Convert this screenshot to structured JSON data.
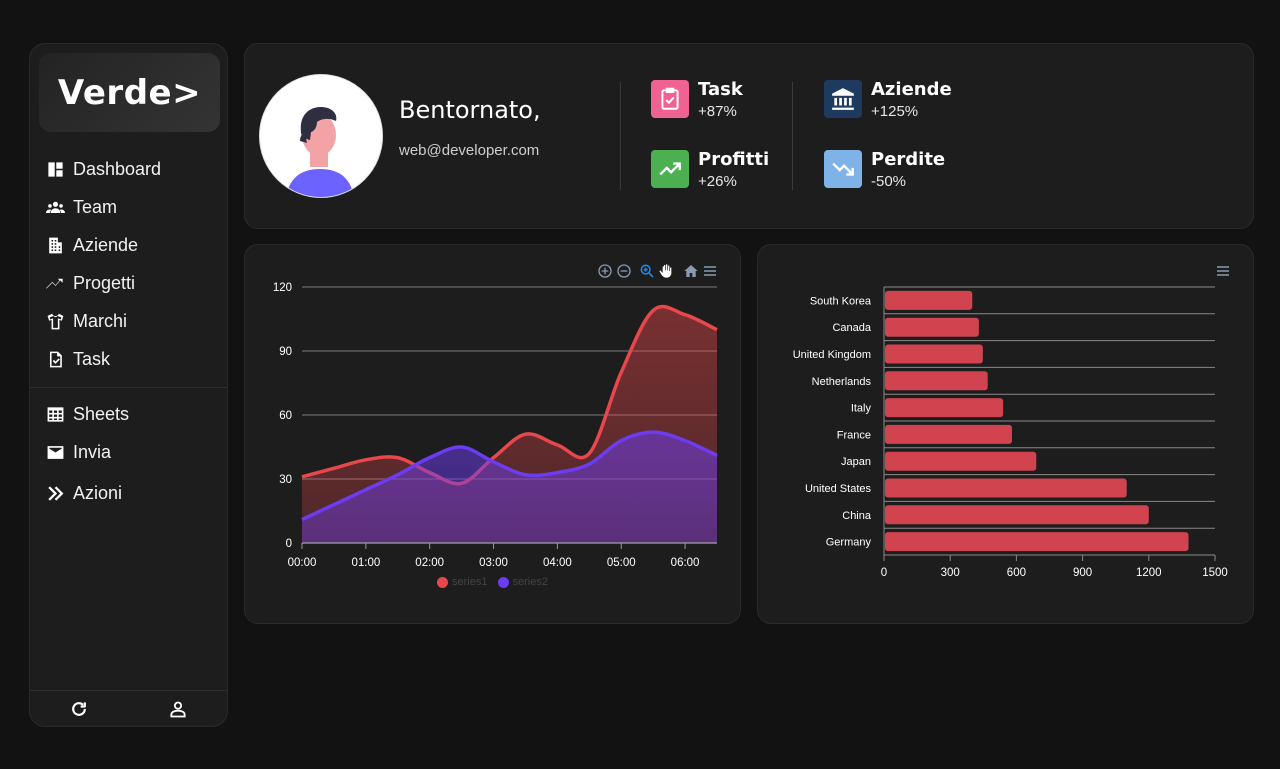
{
  "sidebar": {
    "logo": "Verde>",
    "items": [
      {
        "label": "Dashboard",
        "icon": "dashboard-icon"
      },
      {
        "label": "Team",
        "icon": "team-icon"
      },
      {
        "label": "Aziende",
        "icon": "building-icon"
      },
      {
        "label": "Progetti",
        "icon": "trend-icon"
      },
      {
        "label": "Marchi",
        "icon": "shirt-icon"
      },
      {
        "label": "Task",
        "icon": "task-icon"
      },
      {
        "label": "Sheets",
        "icon": "table-icon"
      },
      {
        "label": "Invia",
        "icon": "mail-icon"
      },
      {
        "label": "Azioni",
        "icon": "double-chevron-icon"
      }
    ],
    "footer": [
      "refresh-icon",
      "user-icon"
    ]
  },
  "profile": {
    "welcome": "Bentornato,",
    "email": "web@developer.com"
  },
  "stats": [
    {
      "title": "Task",
      "value": "+87%",
      "color": "#f06292",
      "icon": "clipboard-check-icon"
    },
    {
      "title": "Profitti",
      "value": "+26%",
      "color": "#4caf50",
      "icon": "trend-up-icon"
    },
    {
      "title": "Aziende",
      "value": "+125%",
      "color": "#1e3a5f",
      "icon": "bank-icon"
    },
    {
      "title": "Perdite",
      "value": "-50%",
      "color": "#7fb3e8",
      "icon": "trend-down-icon"
    }
  ],
  "area_toolbar": [
    "zoom-in-icon",
    "zoom-out-icon",
    "zoom-select-icon",
    "pan-hand-icon",
    "home-icon",
    "menu-icon"
  ],
  "chart_data": [
    {
      "type": "area",
      "x": [
        "00:00",
        "01:00",
        "02:00",
        "03:00",
        "04:00",
        "05:00",
        "06:00"
      ],
      "x_values": [
        0,
        0.5,
        1,
        1.5,
        2,
        2.5,
        3,
        3.5,
        4,
        4.5,
        5,
        5.5,
        6,
        6.5
      ],
      "series": [
        {
          "name": "series1",
          "color": "#e8474c",
          "values": [
            31,
            35,
            39,
            40,
            33,
            28,
            40,
            51,
            46,
            42,
            80,
            109,
            107,
            100
          ]
        },
        {
          "name": "series2",
          "color": "#6c3cf0",
          "values": [
            11,
            18,
            25,
            32,
            40,
            45,
            38,
            32,
            33,
            37,
            48,
            52,
            48,
            41
          ]
        }
      ],
      "ylim": [
        0,
        120
      ],
      "yticks": [
        0,
        30,
        60,
        90,
        120
      ],
      "legend": "bottom",
      "grid": true
    },
    {
      "type": "bar",
      "orientation": "horizontal",
      "categories": [
        "South Korea",
        "Canada",
        "United Kingdom",
        "Netherlands",
        "Italy",
        "France",
        "Japan",
        "United States",
        "China",
        "Germany"
      ],
      "values": [
        400,
        430,
        448,
        470,
        540,
        580,
        690,
        1100,
        1200,
        1380
      ],
      "color": "#d0434f",
      "xlim": [
        0,
        1500
      ],
      "xticks": [
        0,
        300,
        600,
        900,
        1200,
        1500
      ],
      "grid": true
    }
  ]
}
